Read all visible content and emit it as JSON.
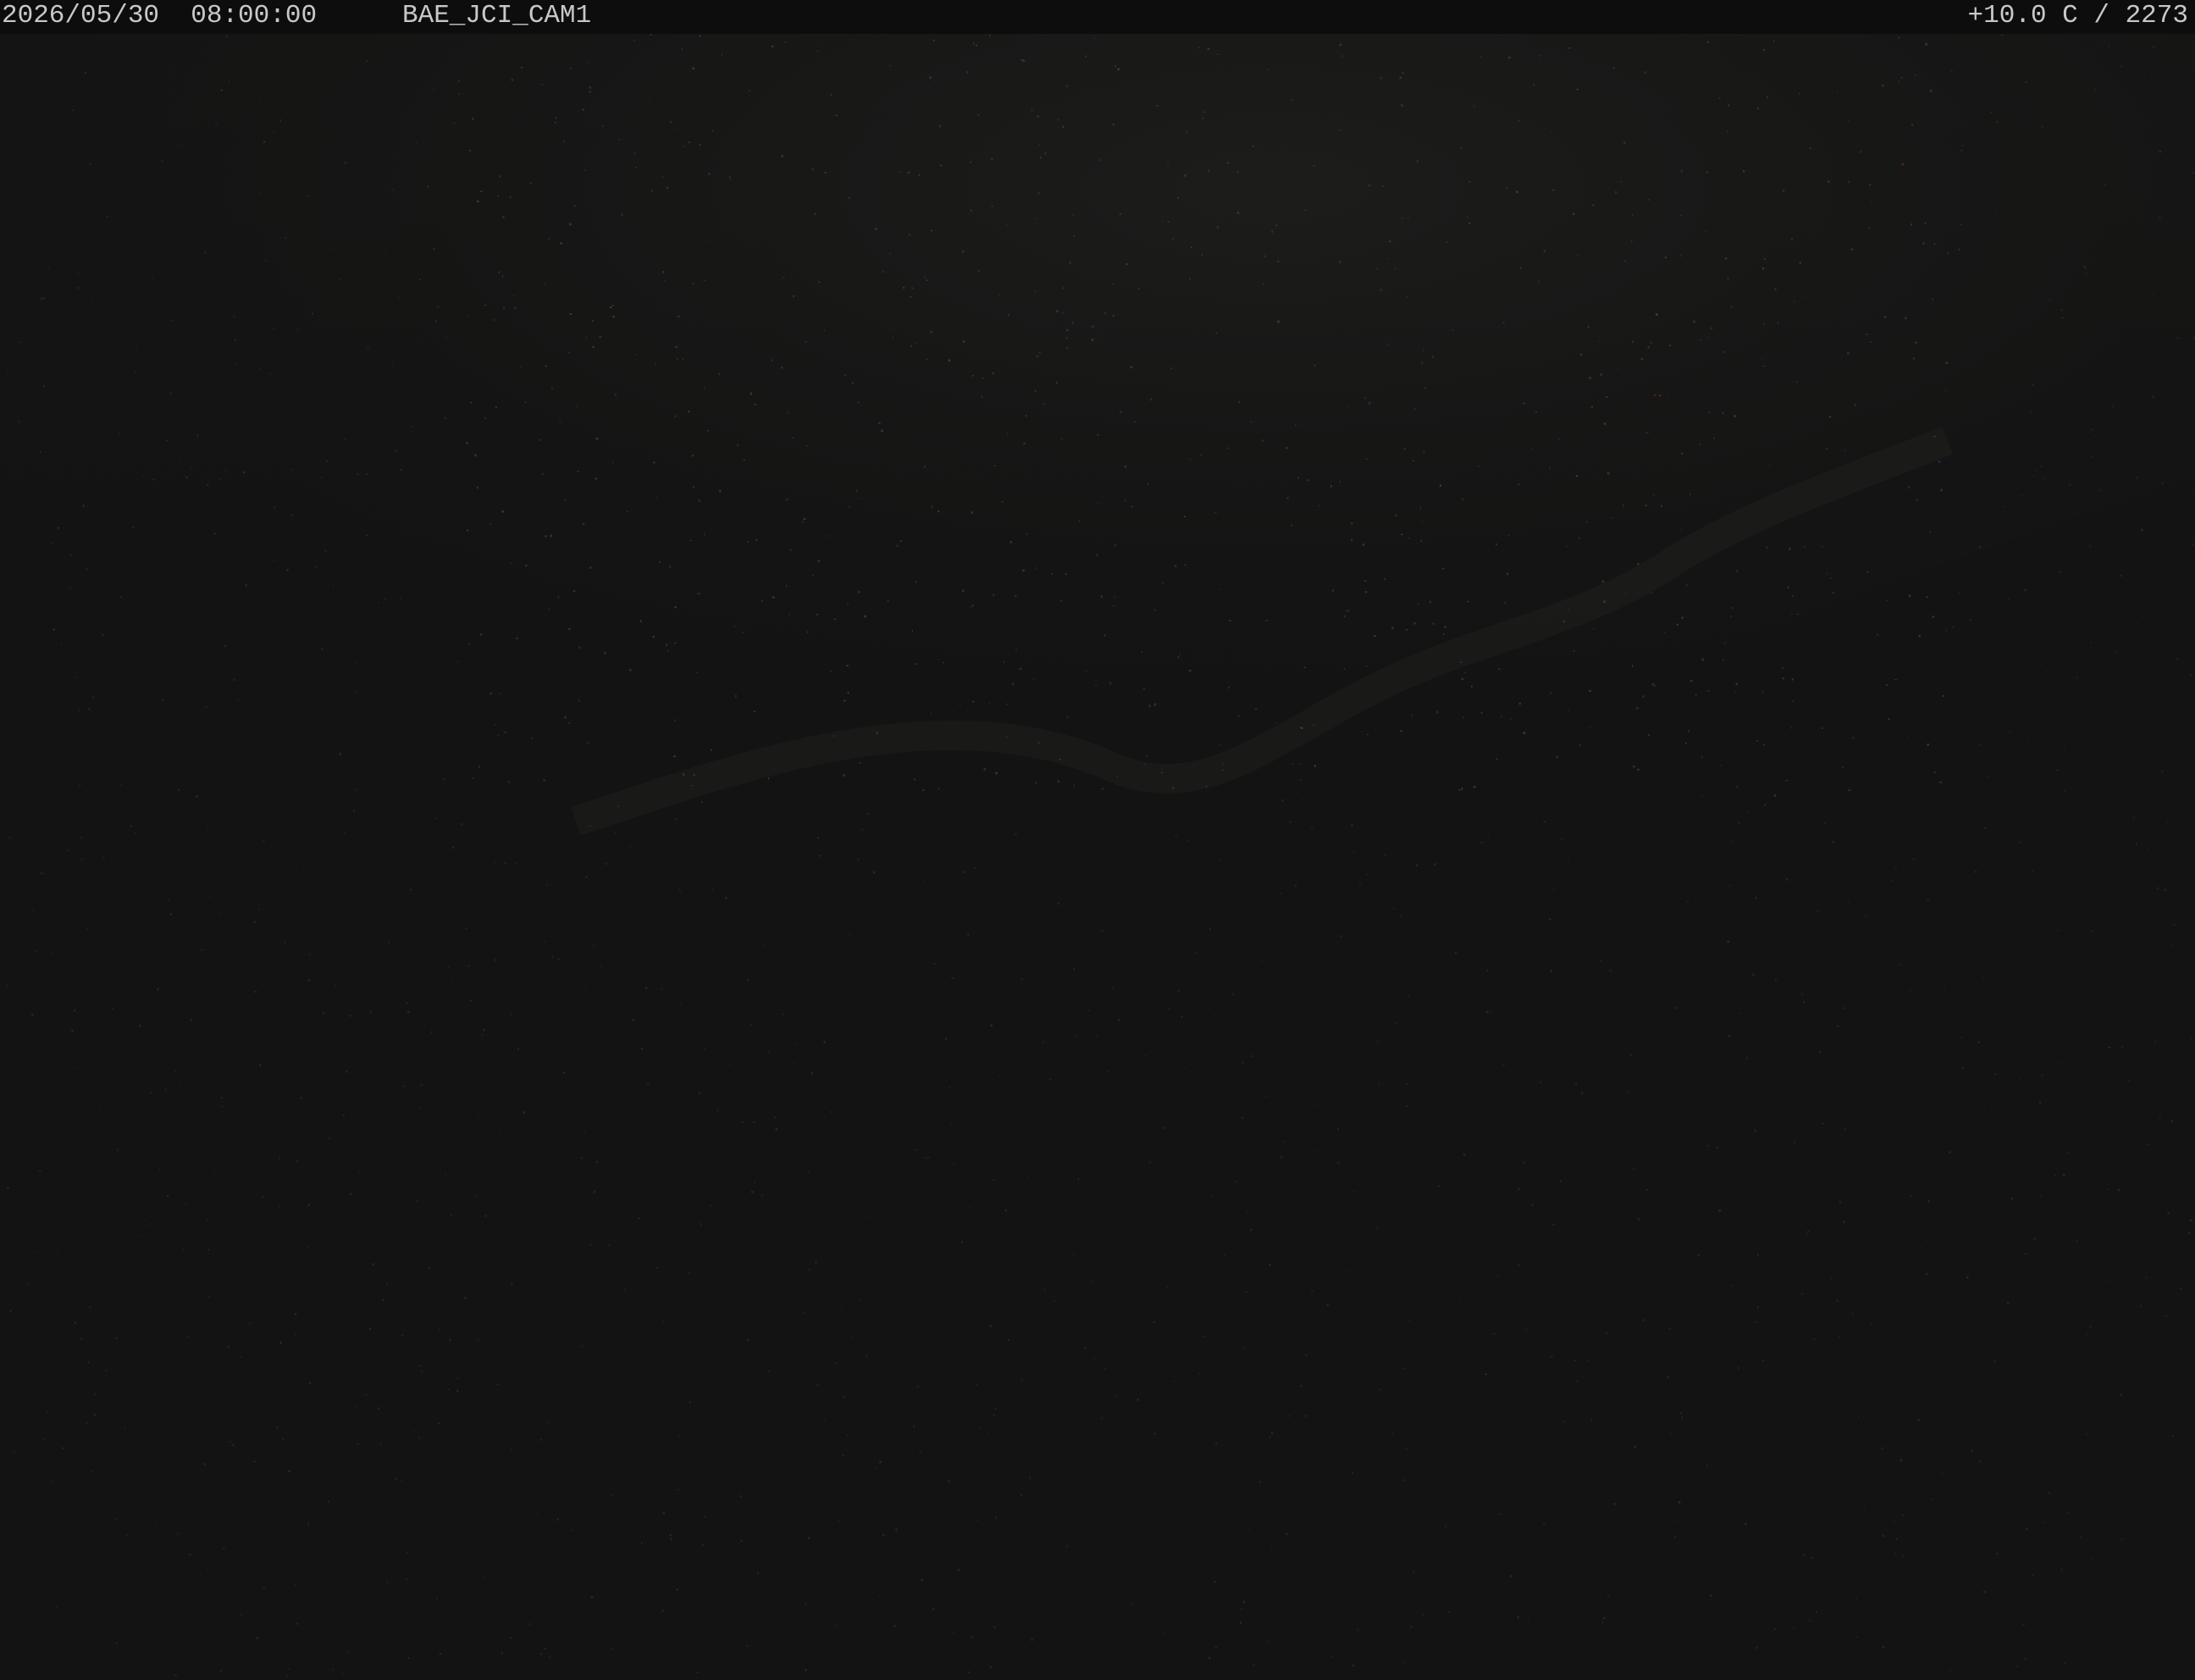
{
  "overlay": {
    "datetime": "2026/05/30  08:00:00",
    "camera_id": "BAE_JCI_CAM1",
    "readout": "+10.0 C / 2273"
  },
  "colors": {
    "background": "#131313",
    "header_background": "#0d0d0d",
    "overlay_text": "#c8c8c8",
    "noise_red": "#a83a3a",
    "noise_green": "#4f6b3b",
    "noise_blue": "#3d4d8a"
  }
}
